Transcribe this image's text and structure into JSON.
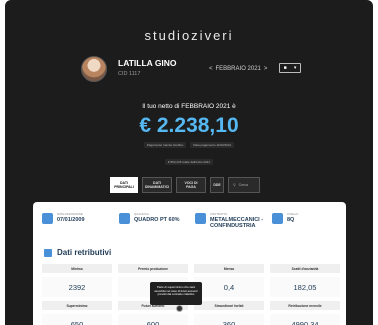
{
  "brand": "studioziveri",
  "user": {
    "name": "LATILLA GINO",
    "id": "CID 1117"
  },
  "month_nav": {
    "prev": "<",
    "label": "FEBBRAIO  2021",
    "next": ">"
  },
  "month_select": {
    "value": "▾"
  },
  "net": {
    "title": "Il tuo netto di FEBBRAIO 2021 è",
    "value": "€ 2.238,10",
    "links": [
      "Pagamento tramite bonifico",
      "Data pagamento 11/02/2021"
    ],
    "note": "€ 853,236 totale dall'inizio 2021"
  },
  "tabs": [
    {
      "label_line1": "DATI",
      "label_line2": "PRINCIPALI",
      "active": true
    },
    {
      "label_line1": "DATI",
      "label_line2": "DINAMIMATICI",
      "active": false
    },
    {
      "label_line1": "VOCI DI PAGA",
      "label_line2": "",
      "active": false
    },
    {
      "label_line1": "DDE",
      "label_line2": "",
      "active": false
    }
  ],
  "search": {
    "placeholder": "Cerca",
    "icon": "search-icon"
  },
  "info": [
    {
      "label": "Data assunzione",
      "value": "07/01/2009",
      "icon": "hire-date-icon",
      "color": "#4a90d9"
    },
    {
      "label": "Qualifica",
      "value": "QUADRO PT 60%",
      "icon": "qualification-icon",
      "color": "#4a90d9"
    },
    {
      "label": "Contratto",
      "value": "METALMECCANICI - CONFINDUSTRIA",
      "icon": "contract-icon",
      "color": "#4a90d9"
    },
    {
      "label": "Livello",
      "value": "8Q",
      "icon": "level-icon",
      "color": "#4a90d9"
    }
  ],
  "section": {
    "title": "Dati retributivi"
  },
  "table": {
    "row1_headers": [
      "Minimo",
      "Premio produzione",
      "Mensa",
      "Scatti d'anzianità"
    ],
    "row1_values": [
      "2392",
      "6",
      "0,4",
      "182,05"
    ],
    "row2_headers": [
      "Superminimo",
      "Futuri aumenti",
      "Straordinari forfait",
      "Retribuzione mensile"
    ],
    "row2_values": [
      "650",
      "600",
      "360",
      "4990,34"
    ]
  },
  "tooltip": "Parte di superminimo che sarà assorbita nel caso di futuri aumenti previsti dal contratto collettivo"
}
